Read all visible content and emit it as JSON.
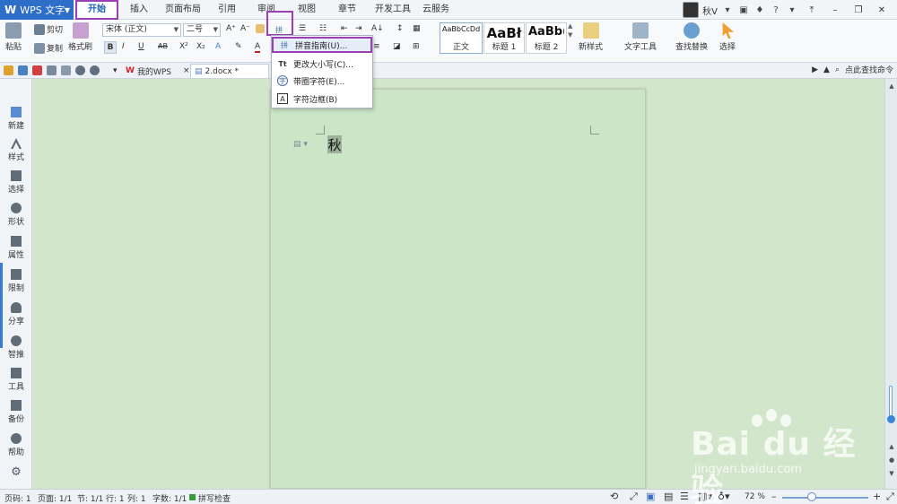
{
  "app": {
    "name": "WPS 文字"
  },
  "menu": {
    "items": [
      "开始",
      "插入",
      "页面布局",
      "引用",
      "审阅",
      "视图",
      "章节",
      "开发工具",
      "云服务"
    ],
    "user": "秋V",
    "help": "?"
  },
  "ribbon": {
    "paste": "粘贴",
    "cut": "剪切",
    "copy": "复制",
    "format_painter": "格式刷",
    "font_name": "宋体 (正文)",
    "font_size": "二号",
    "bold": "B",
    "italic": "I",
    "underline": "U",
    "strike": "AB",
    "superscript": "X²",
    "subscript": "X₂",
    "styles": [
      {
        "sample": "AaBbCcDd",
        "label": "正文"
      },
      {
        "sample": "AaBł",
        "label": "标题 1"
      },
      {
        "sample": "AaBb(",
        "label": "标题 2"
      }
    ],
    "new_style": "新样式",
    "text_tools": "文字工具",
    "find_replace": "查找替换",
    "select": "选择"
  },
  "tabs": {
    "wps_tab": "我的WPS",
    "doc_tab": "2.docx *",
    "search_cmd": "点此查找命令"
  },
  "dropdown": {
    "items": [
      {
        "label": "拼音指南(U)...",
        "icon": "pinyin-icon"
      },
      {
        "label": "更改大小写(C)...",
        "icon": "case-icon"
      },
      {
        "label": "带圈字符(E)...",
        "icon": "circle-char-icon"
      },
      {
        "label": "字符边框(B)",
        "icon": "char-border-icon"
      }
    ]
  },
  "sidebar": {
    "items": [
      "新建",
      "样式",
      "选择",
      "形状",
      "属性",
      "限制",
      "分享",
      "智推",
      "工具",
      "备份",
      "帮助"
    ]
  },
  "document": {
    "text": "秋"
  },
  "status": {
    "page_num": "页码: 1",
    "pages": "页面: 1/1",
    "section": "节: 1/1",
    "line": "行: 1",
    "column": "列: 1",
    "words": "字数: 1/1",
    "spell": "拼写检查",
    "zoom": "72 %"
  },
  "watermark": {
    "brand": "Bai du 经验",
    "url": "jingyan.baidu.com"
  }
}
